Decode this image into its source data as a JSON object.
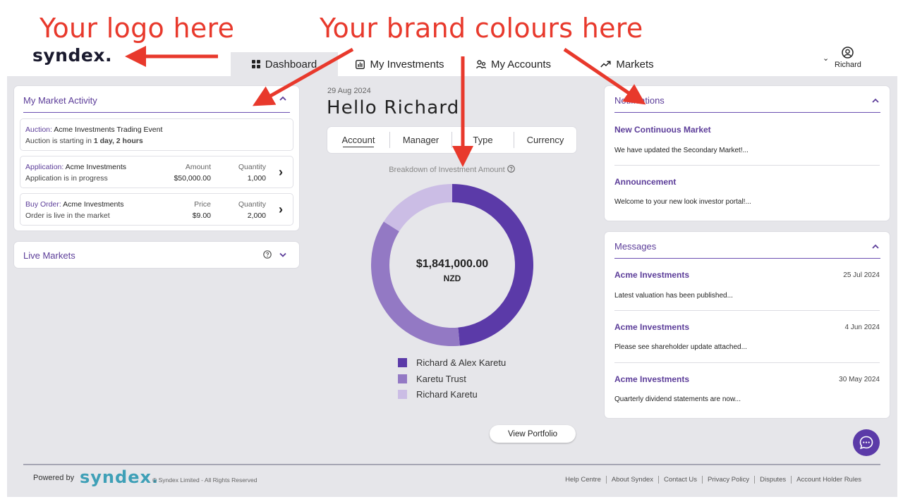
{
  "annotations": {
    "logo_callout": "Your logo here",
    "brand_callout": "Your brand colours here",
    "arrow_color": "#e8392c"
  },
  "brand": {
    "logo_text": "syndex."
  },
  "nav": {
    "tabs": [
      {
        "label": "Dashboard",
        "icon": "dashboard-grid-icon",
        "active": true
      },
      {
        "label": "My Investments",
        "icon": "investments-chart-icon",
        "active": false
      },
      {
        "label": "My Accounts",
        "icon": "accounts-people-icon",
        "active": false
      },
      {
        "label": "Markets",
        "icon": "markets-trend-icon",
        "active": false
      }
    ],
    "user": {
      "name": "Richard",
      "icon": "user-circle-icon"
    }
  },
  "market_activity": {
    "title": "My Market Activity",
    "items": [
      {
        "label": "Auction:",
        "name": "Acme Investments Trading Event",
        "status_prefix": "Auction is starting in ",
        "status_bold": "1 day, 2 hours"
      },
      {
        "label": "Application:",
        "name": "Acme Investments",
        "status": "Application is in progress",
        "col1_header": "Amount",
        "col1_value": "$50,000.00",
        "col2_header": "Quantity",
        "col2_value": "1,000"
      },
      {
        "label": "Buy Order:",
        "name": "Acme Investments",
        "status": "Order is live in the market",
        "col1_header": "Price",
        "col1_value": "$9.00",
        "col2_header": "Quantity",
        "col2_value": "2,000"
      }
    ]
  },
  "live_markets": {
    "title": "Live Markets"
  },
  "dashboard": {
    "date": "29 Aug 2024",
    "greeting": "Hello Richard",
    "segments": [
      "Account",
      "Manager",
      "Type",
      "Currency"
    ],
    "active_segment": "Account",
    "view_portfolio": "View Portfolio"
  },
  "chart_data": {
    "type": "pie",
    "title": "Breakdown of Investment Amount",
    "center_value": "$1,841,000.00",
    "center_unit": "NZD",
    "categories": [
      "Richard & Alex Karetu",
      "Karetu Trust",
      "Richard Karetu"
    ],
    "values": [
      0.485,
      0.355,
      0.16
    ],
    "colors": [
      "#5b3aa8",
      "#9379c4",
      "#cbbde5"
    ],
    "legend_position": "bottom"
  },
  "notifications": {
    "title": "Notifications",
    "items": [
      {
        "title": "New Continuous Market",
        "body": "We have updated the Secondary Market!..."
      },
      {
        "title": "Announcement",
        "body": "Welcome to your new look investor portal!..."
      }
    ]
  },
  "messages": {
    "title": "Messages",
    "items": [
      {
        "title": "Acme Investments",
        "date": "25 Jul 2024",
        "body": "Latest valuation has been published..."
      },
      {
        "title": "Acme Investments",
        "date": "4 Jun 2024",
        "body": "Please see shareholder update attached..."
      },
      {
        "title": "Acme Investments",
        "date": "30 May 2024",
        "body": "Quarterly dividend statements are now..."
      }
    ]
  },
  "footer": {
    "powered_by": "Powered by",
    "logo_text": "syndex.",
    "copyright": "© Syndex Limited - All Rights Reserved",
    "links": [
      "Help Centre",
      "About Syndex",
      "Contact Us",
      "Privacy Policy",
      "Disputes",
      "Account Holder Rules"
    ]
  },
  "colors": {
    "accent": "#5c3d99",
    "chart_dark": "#5b3aa8",
    "chart_mid": "#9379c4",
    "chart_light": "#cbbde5",
    "footer_logo": "#3fa0b7",
    "app_background": "#e6e6ea"
  }
}
